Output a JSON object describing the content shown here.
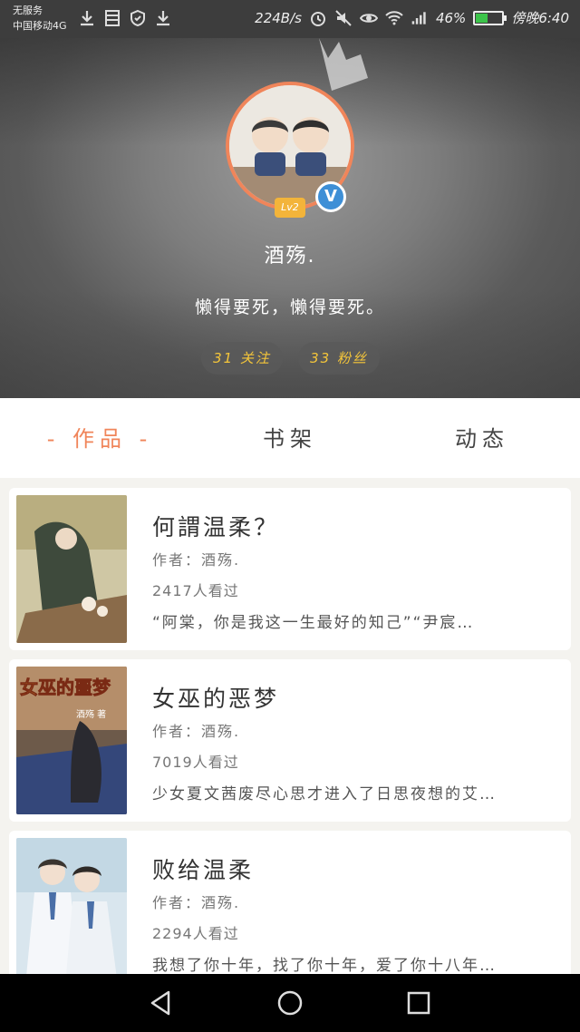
{
  "status_bar": {
    "carrier_line1": "无服务",
    "carrier_line2": "中国移动4G",
    "net_speed": "224B/s",
    "network": "4G",
    "battery": "46%",
    "battery_level": 0.46,
    "time": "傍晚6:40",
    "icons_left": [
      "download-icon",
      "storage-icon",
      "shield-icon",
      "download-icon"
    ],
    "icons_right": [
      "alarm-icon",
      "mute-icon",
      "eye-icon",
      "wifi-icon",
      "signal-icon",
      "battery-icon"
    ]
  },
  "profile": {
    "level": "Lv2",
    "verified": "V",
    "username": "酒殇.",
    "bio": "懒得要死，懒得要死。",
    "following": "31 关注",
    "followers": "33 粉丝"
  },
  "tabs": [
    {
      "label": "- 作品 -",
      "active": true
    },
    {
      "label": "书架",
      "active": false
    },
    {
      "label": "动态",
      "active": false
    }
  ],
  "books": [
    {
      "title": "何謂温柔？",
      "author": "作者：酒殇.",
      "views": "2417人看过",
      "excerpt": "“阿棠，你是我这一生最好的知己”“尹宸…",
      "cover_text": ""
    },
    {
      "title": "女巫的恶梦",
      "author": "作者：酒殇.",
      "views": "7019人看过",
      "excerpt": "少女夏文茜废尽心思才进入了日思夜想的艾…",
      "cover_text": "女巫的噩梦",
      "cover_subtext": "酒殇 著"
    },
    {
      "title": "败给温柔",
      "author": "作者：酒殇.",
      "views": "2294人看过",
      "excerpt": "我想了你十年，找了你十年，爱了你十八年…",
      "cover_text": ""
    }
  ],
  "colors": {
    "accent": "#f0855a",
    "badge_yellow": "#f3b43a",
    "verified_blue": "#3e8fd6",
    "pill_text": "#f5c63a"
  }
}
